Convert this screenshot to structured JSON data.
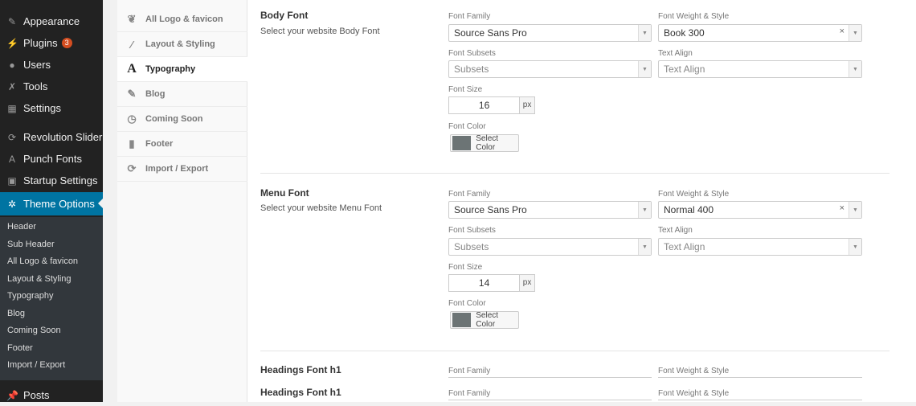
{
  "wp_menu": {
    "items": [
      {
        "label": "Appearance",
        "icon": "paintbrush-icon"
      },
      {
        "label": "Plugins",
        "icon": "plugin-icon",
        "badge": "3"
      },
      {
        "label": "Users",
        "icon": "users-icon"
      },
      {
        "label": "Tools",
        "icon": "wrench-icon"
      },
      {
        "label": "Settings",
        "icon": "settings-icon"
      },
      {
        "label": "Revolution Slider",
        "icon": "refresh-icon"
      },
      {
        "label": "Punch Fonts",
        "icon": "font-icon"
      },
      {
        "label": "Startup Settings",
        "icon": "panel-icon"
      },
      {
        "label": "Theme Options",
        "icon": "gear-icon"
      },
      {
        "label": "Posts",
        "icon": "pin-icon"
      }
    ],
    "submenu": [
      "Header",
      "Sub Header",
      "All Logo & favicon",
      "Layout & Styling",
      "Typography",
      "Blog",
      "Coming Soon",
      "Footer",
      "Import / Export"
    ]
  },
  "options_nav": {
    "items": [
      {
        "label": "All Logo & favicon",
        "icon": "leaf-icon"
      },
      {
        "label": "Layout & Styling",
        "icon": "pencil-icon"
      },
      {
        "label": "Typography",
        "icon": "typography-icon"
      },
      {
        "label": "Blog",
        "icon": "edit-icon"
      },
      {
        "label": "Coming Soon",
        "icon": "clock-icon"
      },
      {
        "label": "Footer",
        "icon": "bookmark-icon"
      },
      {
        "label": "Import / Export",
        "icon": "refresh-icon"
      }
    ],
    "active": "Typography"
  },
  "labels": {
    "font_family": "Font Family",
    "font_weight": "Font Weight & Style",
    "font_subsets": "Font Subsets",
    "text_align": "Text Align",
    "font_size": "Font Size",
    "font_color": "Font Color",
    "select_color": "Select Color",
    "unit": "px"
  },
  "body_font": {
    "title": "Body Font",
    "desc": "Select your website Body Font",
    "family": "Source Sans Pro",
    "weight": "Book 300",
    "subsets_placeholder": "Subsets",
    "align_placeholder": "Text Align",
    "size": "16",
    "color": "#6c7475"
  },
  "menu_font": {
    "title": "Menu Font",
    "desc": "Select your website Menu Font",
    "family": "Source Sans Pro",
    "weight": "Normal 400",
    "subsets_placeholder": "Subsets",
    "align_placeholder": "Text Align",
    "size": "14",
    "color": "#6c7475"
  },
  "headings": [
    {
      "title": "Headings Font h1"
    },
    {
      "title": "Headings Font h1"
    }
  ],
  "colors": {
    "accent": "#0074a2",
    "badge": "#d54e21",
    "menu_bg": "#222222"
  }
}
